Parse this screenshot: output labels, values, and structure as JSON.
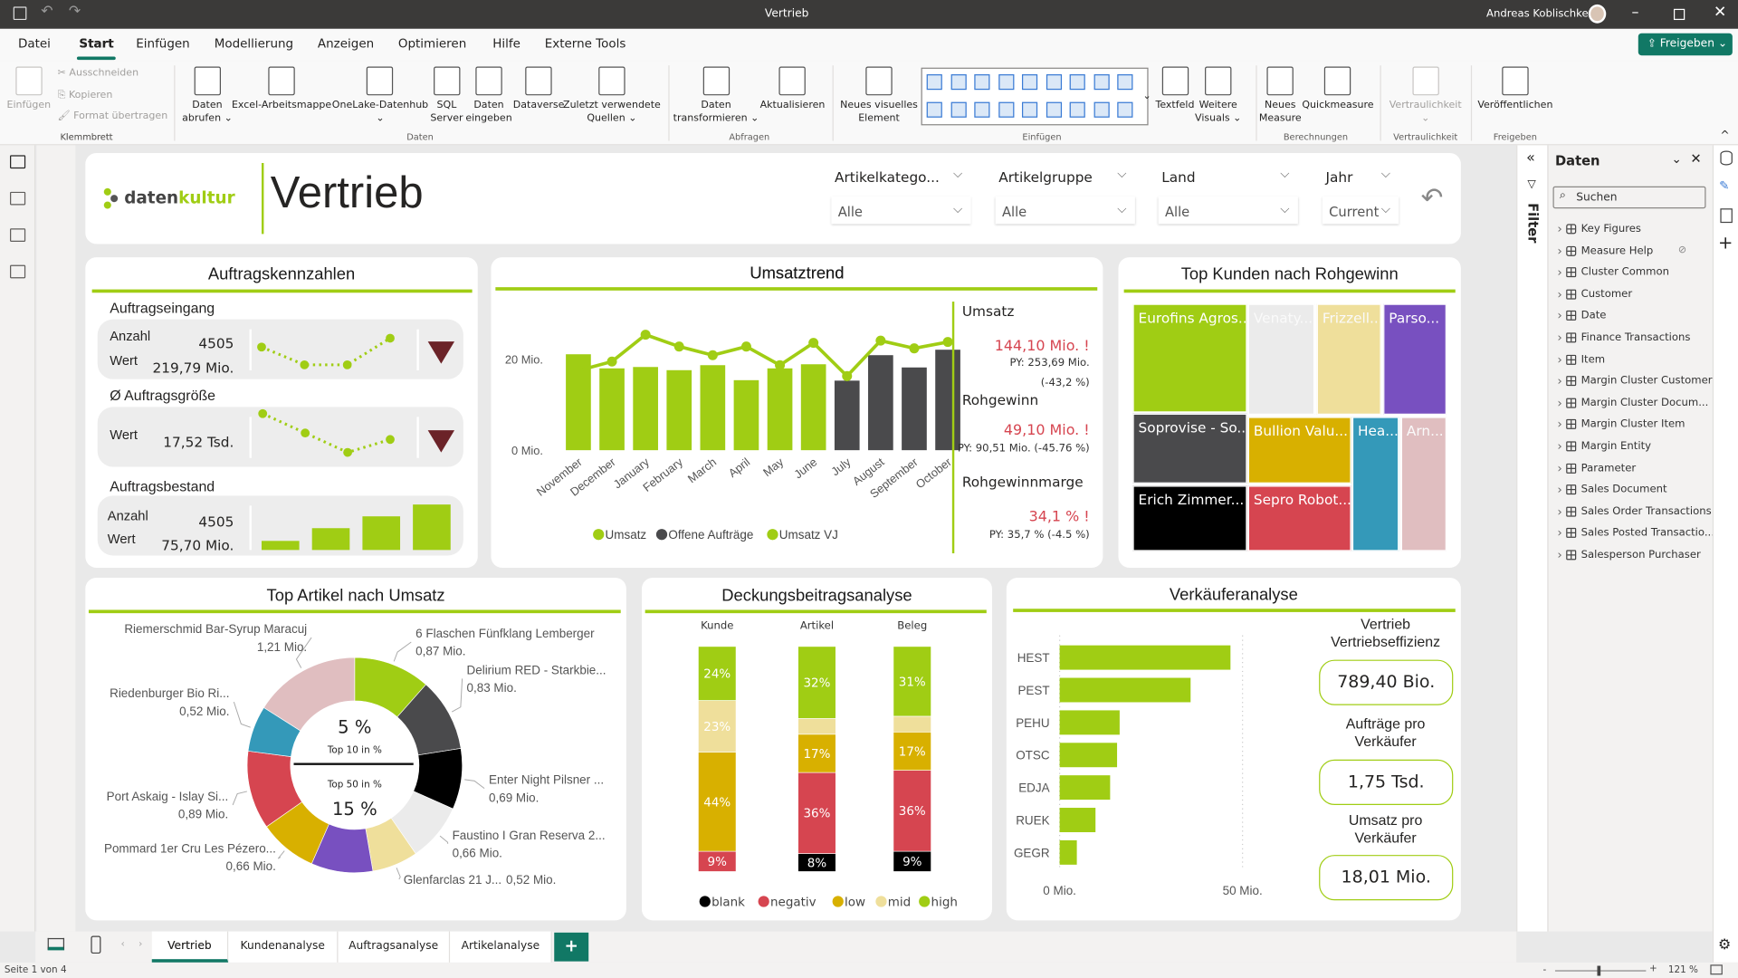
{
  "titlebar": {
    "title": "Vertrieb",
    "user": "Andreas Koblischke",
    "icons": [
      "save-icon",
      "undo-icon",
      "redo-icon"
    ]
  },
  "menu": {
    "items": [
      "Datei",
      "Start",
      "Einfügen",
      "Modellierung",
      "Anzeigen",
      "Optimieren",
      "Hilfe",
      "Externe Tools"
    ],
    "active": "Start",
    "share_label": "Freigeben"
  },
  "ribbon": {
    "clipboard": {
      "paste": "Einfügen",
      "cut": "Ausschneiden",
      "copy": "Kopieren",
      "format": "Format übertragen",
      "group": "Klemmbrett"
    },
    "items": [
      {
        "label": "Daten\nabrufen ⌄",
        "icon": "database-icon"
      },
      {
        "label": "Excel-Arbeitsmappe",
        "icon": "excel-icon"
      },
      {
        "label": "OneLake-Datenhub\n⌄",
        "icon": "onelake-icon"
      },
      {
        "label": "SQL\nServer",
        "icon": "sql-server-icon"
      },
      {
        "label": "Daten\neingeben",
        "icon": "table-enter-icon"
      },
      {
        "label": "Dataverse",
        "icon": "dataverse-icon"
      },
      {
        "label": "Zuletzt verwendete\nQuellen ⌄",
        "icon": "recent-sources-icon"
      },
      {
        "label": "Daten\ntransformieren ⌄",
        "icon": "transform-icon"
      },
      {
        "label": "Aktualisieren",
        "icon": "refresh-icon"
      },
      {
        "label": "Neues visuelles\nElement",
        "icon": "new-visual-icon"
      },
      {
        "label": "Textfeld",
        "icon": "textbox-icon"
      },
      {
        "label": "Weitere\nVisuals ⌄",
        "icon": "more-visuals-icon"
      },
      {
        "label": "Neues\nMeasure",
        "icon": "measure-icon"
      },
      {
        "label": "Quickmeasure",
        "icon": "quickmeasure-icon"
      },
      {
        "label": "Vertraulichkeit\n⌄",
        "icon": "sensitivity-icon",
        "disabled": true
      },
      {
        "label": "Veröffentlichen",
        "icon": "publish-icon"
      }
    ],
    "groups": [
      "Klemmbrett",
      "Daten",
      "Abfragen",
      "Einfügen",
      "Berechnungen",
      "Vertraulichkeit",
      "Freigeben"
    ]
  },
  "header": {
    "logo": "datenkultur",
    "title": "Vertrieb",
    "slicers": [
      {
        "label": "Artikelkatego...",
        "value": "Alle"
      },
      {
        "label": "Artikelgruppe",
        "value": "Alle"
      },
      {
        "label": "Land",
        "value": "Alle"
      },
      {
        "label": "Jahr",
        "value": "Current"
      }
    ]
  },
  "kennzahlen": {
    "title": "Auftragskennzahlen",
    "eingang": {
      "title": "Auftragseingang",
      "anzahl_label": "Anzahl",
      "anzahl": "4505",
      "wert_label": "Wert",
      "wert": "219,79 Mio.",
      "trend": "down",
      "sparkline": [
        3,
        1,
        1,
        4
      ]
    },
    "groesse": {
      "title": "Ø Auftragsgröße",
      "wert_label": "Wert",
      "wert": "17,52 Tsd.",
      "trend": "down",
      "sparkline": [
        4,
        2.5,
        1,
        2
      ]
    },
    "bestand": {
      "title": "Auftragsbestand",
      "anzahl_label": "Anzahl",
      "anzahl": "4505",
      "wert_label": "Wert",
      "wert": "75,70 Mio.",
      "bars": [
        1,
        2.4,
        3.7,
        5
      ]
    }
  },
  "umsatztrend": {
    "title": "Umsatztrend",
    "kpis": [
      {
        "label": "Umsatz",
        "value": "144,10 Mio. !",
        "py": "PY: 253,69 Mio.",
        "change": "(-43,2 %)"
      },
      {
        "label": "Rohgewinn",
        "value": "49,10 Mio. !",
        "py": "PY: 90,51 Mio. (-45.76 %)"
      },
      {
        "label": "Rohgewinnmarge",
        "value": "34,1 % !",
        "py": "PY: 35,7 % (-4.5 %)"
      }
    ]
  },
  "chart_data": [
    {
      "type": "bar",
      "title": "Umsatztrend",
      "categories": [
        "November",
        "December",
        "January",
        "February",
        "March",
        "April",
        "May",
        "June",
        "July",
        "August",
        "September",
        "October"
      ],
      "series": [
        {
          "name": "Umsatz",
          "kind": "bar",
          "color": "#a0cd14",
          "values": [
            21.1,
            18.0,
            18.3,
            17.6,
            18.7,
            15.4,
            18.0,
            18.9,
            null,
            null,
            null,
            null
          ]
        },
        {
          "name": "Offene Aufträge",
          "kind": "bar",
          "color": "#4a4a4c",
          "values": [
            null,
            null,
            null,
            null,
            null,
            null,
            null,
            null,
            15.3,
            20.9,
            18.2,
            22.1
          ]
        },
        {
          "name": "Umsatz VJ",
          "kind": "line",
          "color": "#a0cd14",
          "values": [
            17.5,
            19.5,
            25.4,
            22.8,
            20.9,
            22.8,
            18.7,
            23.6,
            16.3,
            24.1,
            22.4,
            23.8
          ]
        }
      ],
      "yticks": [
        "0 Mio.",
        "20 Mio."
      ],
      "ylim": [
        0,
        20
      ],
      "legend": "bottom"
    },
    {
      "type": "treemap",
      "title": "Top Kunden nach Rohgewinn",
      "items": [
        {
          "name": "Eurofins Agros...",
          "color": "#a0cd14"
        },
        {
          "name": "Venaty...",
          "color": "#ebebeb"
        },
        {
          "name": "Frizzell...",
          "color": "#efdf9b"
        },
        {
          "name": "Parso...",
          "color": "#7850c0"
        },
        {
          "name": "Soprovise - So...",
          "color": "#4a4a4c"
        },
        {
          "name": "Erich Zimmer...",
          "color": "#000000"
        },
        {
          "name": "Bullion Valu...",
          "color": "#d8b000"
        },
        {
          "name": "Sepro Robot...",
          "color": "#d64550"
        },
        {
          "name": "Hea...",
          "color": "#3499b9"
        },
        {
          "name": "Arn...",
          "color": "#e0bec0"
        }
      ]
    },
    {
      "type": "pie",
      "title": "Top Artikel nach Umsatz",
      "unit": "Mio.",
      "slices": [
        {
          "name": "6 Flaschen Fünfklang Lemberger",
          "value": 0.87,
          "label": "0,87 Mio.",
          "color": "#a0cd14"
        },
        {
          "name": "Delirium RED - Starkbie...",
          "value": 0.83,
          "label": "0,83 Mio.",
          "color": "#4a4a4c"
        },
        {
          "name": "Enter Night Pilsner ...",
          "value": 0.69,
          "label": "0,69 Mio.",
          "color": "#000000"
        },
        {
          "name": "Faustino I Gran Reserva 2...",
          "value": 0.66,
          "label": "0,66 Mio.",
          "color": "#ebebeb"
        },
        {
          "name": "Glenfarclas 21 J...",
          "value": 0.52,
          "label": "0,52 Mio.",
          "color": "#efdf9b"
        },
        {
          "name": "",
          "value": 0.7,
          "label": "",
          "color": "#7850c0"
        },
        {
          "name": "Pommard 1er Cru Les Pézero...",
          "value": 0.66,
          "label": "0,66 Mio.",
          "color": "#d8b000"
        },
        {
          "name": "Port Askaig - Islay Si...",
          "value": 0.89,
          "label": "0,89 Mio.",
          "color": "#d64550"
        },
        {
          "name": "Riedenburger Bio Ri...",
          "value": 0.52,
          "label": "0,52 Mio.",
          "color": "#3499b9"
        },
        {
          "name": "Riemerschmid Bar-Syrup Maracuj",
          "value": 1.21,
          "label": "1,21 Mio.",
          "color": "#e0bec0"
        }
      ],
      "center": {
        "top_value": "5 %",
        "top_label": "Top 10 in %",
        "bottom_label": "Top 50 in %",
        "bottom_value": "15 %"
      }
    },
    {
      "type": "bar",
      "stacked": true,
      "title": "Deckungsbeitragsanalyse",
      "categories": [
        "Kunde",
        "Artikel",
        "Beleg"
      ],
      "series": [
        {
          "name": "blank",
          "color": "#000000",
          "values": [
            0,
            8,
            9
          ]
        },
        {
          "name": "negativ",
          "color": "#d64550",
          "values": [
            9,
            36,
            36
          ]
        },
        {
          "name": "low",
          "color": "#d8b000",
          "values": [
            44,
            17,
            17
          ]
        },
        {
          "name": "mid",
          "color": "#efdf9b",
          "values": [
            23,
            7,
            7
          ]
        },
        {
          "name": "high",
          "color": "#a0cd14",
          "values": [
            24,
            32,
            31
          ]
        }
      ],
      "unit": "%",
      "legend": "bottom"
    },
    {
      "type": "bar",
      "orientation": "horizontal",
      "title": "Verkäuferanalyse",
      "categories": [
        "HEST",
        "PEST",
        "PEHU",
        "OTSC",
        "EDJA",
        "RUEK",
        "GEGR"
      ],
      "values": [
        46.7,
        35.8,
        16.4,
        15.7,
        13.8,
        9.8,
        4.7
      ],
      "xticks": [
        "0 Mio.",
        "50 Mio."
      ],
      "xlim": [
        0,
        50
      ],
      "color": "#a0cd14"
    }
  ],
  "verkaeufer": {
    "kpis": [
      {
        "label": "Vertrieb\nVertriebseffizienz",
        "value": "789,40 Bio."
      },
      {
        "label": "Aufträge pro\nVerkäufer",
        "value": "1,75 Tsd."
      },
      {
        "label": "Umsatz pro\nVerkäufer",
        "value": "18,01 Mio."
      }
    ]
  },
  "filter": {
    "label": "Filter"
  },
  "daten": {
    "title": "Daten",
    "search_placeholder": "Suchen",
    "items": [
      {
        "name": "Key Figures",
        "icon": "calculator-icon"
      },
      {
        "name": "Measure Help",
        "icon": "calculator-icon",
        "hidden": true
      },
      {
        "name": "Cluster Common",
        "icon": "table-icon"
      },
      {
        "name": "Customer",
        "icon": "table-icon"
      },
      {
        "name": "Date",
        "icon": "table-icon"
      },
      {
        "name": "Finance Transactions",
        "icon": "table-icon"
      },
      {
        "name": "Item",
        "icon": "table-icon"
      },
      {
        "name": "Margin Cluster Customer",
        "icon": "table-icon"
      },
      {
        "name": "Margin Cluster Docum...",
        "icon": "calculated-table-icon"
      },
      {
        "name": "Margin Cluster Item",
        "icon": "calculated-table-icon"
      },
      {
        "name": "Margin Entity",
        "icon": "table-icon"
      },
      {
        "name": "Parameter",
        "icon": "table-icon"
      },
      {
        "name": "Sales Document",
        "icon": "table-icon"
      },
      {
        "name": "Sales Order Transactions",
        "icon": "table-icon"
      },
      {
        "name": "Sales Posted Transactio...",
        "icon": "table-icon"
      },
      {
        "name": "Salesperson Purchaser",
        "icon": "table-icon"
      }
    ]
  },
  "pages": {
    "tabs": [
      "Vertrieb",
      "Kundenanalyse",
      "Auftragsanalyse",
      "Artikelanalyse"
    ],
    "active": "Vertrieb",
    "add": "+"
  },
  "status": {
    "page": "Seite 1 von 4",
    "zoom": "121 %"
  },
  "colors": {
    "accent": "#a0cd14",
    "brand_teal": "#117865",
    "negative": "#d64550",
    "trend_down": "#6b2328"
  }
}
